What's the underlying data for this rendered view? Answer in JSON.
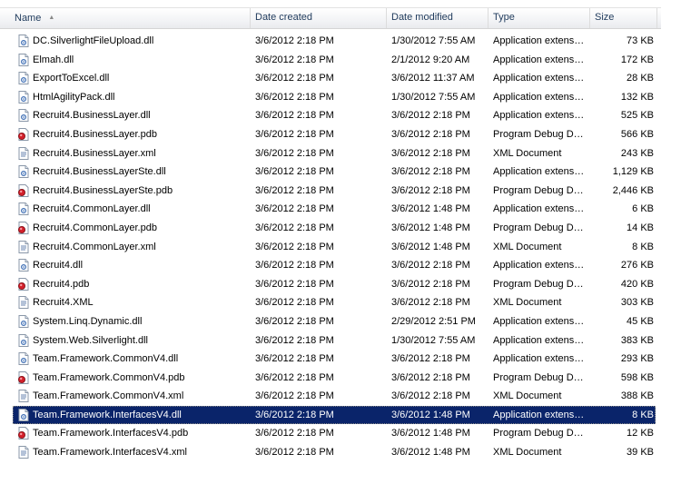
{
  "columns": {
    "name": "Name",
    "date_created": "Date created",
    "date_modified": "Date modified",
    "type": "Type",
    "size": "Size"
  },
  "colors": {
    "selection": "#0a246a",
    "header_text": "#1e395b"
  },
  "files": [
    {
      "name": "DC.SilverlightFileUpload.dll",
      "created": "3/6/2012 2:18 PM",
      "modified": "1/30/2012 7:55 AM",
      "type": "Application extension",
      "size": "73 KB",
      "icon": "dll-icon"
    },
    {
      "name": "Elmah.dll",
      "created": "3/6/2012 2:18 PM",
      "modified": "2/1/2012 9:20 AM",
      "type": "Application extension",
      "size": "172 KB",
      "icon": "dll-icon"
    },
    {
      "name": "ExportToExcel.dll",
      "created": "3/6/2012 2:18 PM",
      "modified": "3/6/2012 11:37 AM",
      "type": "Application extension",
      "size": "28 KB",
      "icon": "dll-icon"
    },
    {
      "name": "HtmlAgilityPack.dll",
      "created": "3/6/2012 2:18 PM",
      "modified": "1/30/2012 7:55 AM",
      "type": "Application extension",
      "size": "132 KB",
      "icon": "dll-icon"
    },
    {
      "name": "Recruit4.BusinessLayer.dll",
      "created": "3/6/2012 2:18 PM",
      "modified": "3/6/2012 2:18 PM",
      "type": "Application extension",
      "size": "525 KB",
      "icon": "dll-icon"
    },
    {
      "name": "Recruit4.BusinessLayer.pdb",
      "created": "3/6/2012 2:18 PM",
      "modified": "3/6/2012 2:18 PM",
      "type": "Program Debug Dat...",
      "size": "566 KB",
      "icon": "pdb-icon"
    },
    {
      "name": "Recruit4.BusinessLayer.xml",
      "created": "3/6/2012 2:18 PM",
      "modified": "3/6/2012 2:18 PM",
      "type": "XML Document",
      "size": "243 KB",
      "icon": "xml-icon"
    },
    {
      "name": "Recruit4.BusinessLayerSte.dll",
      "created": "3/6/2012 2:18 PM",
      "modified": "3/6/2012 2:18 PM",
      "type": "Application extension",
      "size": "1,129 KB",
      "icon": "dll-icon"
    },
    {
      "name": "Recruit4.BusinessLayerSte.pdb",
      "created": "3/6/2012 2:18 PM",
      "modified": "3/6/2012 2:18 PM",
      "type": "Program Debug Dat...",
      "size": "2,446 KB",
      "icon": "pdb-icon"
    },
    {
      "name": "Recruit4.CommonLayer.dll",
      "created": "3/6/2012 2:18 PM",
      "modified": "3/6/2012 1:48 PM",
      "type": "Application extension",
      "size": "6 KB",
      "icon": "dll-icon"
    },
    {
      "name": "Recruit4.CommonLayer.pdb",
      "created": "3/6/2012 2:18 PM",
      "modified": "3/6/2012 1:48 PM",
      "type": "Program Debug Dat...",
      "size": "14 KB",
      "icon": "pdb-icon"
    },
    {
      "name": "Recruit4.CommonLayer.xml",
      "created": "3/6/2012 2:18 PM",
      "modified": "3/6/2012 1:48 PM",
      "type": "XML Document",
      "size": "8 KB",
      "icon": "xml-icon"
    },
    {
      "name": "Recruit4.dll",
      "created": "3/6/2012 2:18 PM",
      "modified": "3/6/2012 2:18 PM",
      "type": "Application extension",
      "size": "276 KB",
      "icon": "dll-icon"
    },
    {
      "name": "Recruit4.pdb",
      "created": "3/6/2012 2:18 PM",
      "modified": "3/6/2012 2:18 PM",
      "type": "Program Debug Dat...",
      "size": "420 KB",
      "icon": "pdb-icon"
    },
    {
      "name": "Recruit4.XML",
      "created": "3/6/2012 2:18 PM",
      "modified": "3/6/2012 2:18 PM",
      "type": "XML Document",
      "size": "303 KB",
      "icon": "xml-icon"
    },
    {
      "name": "System.Linq.Dynamic.dll",
      "created": "3/6/2012 2:18 PM",
      "modified": "2/29/2012 2:51 PM",
      "type": "Application extension",
      "size": "45 KB",
      "icon": "dll-icon"
    },
    {
      "name": "System.Web.Silverlight.dll",
      "created": "3/6/2012 2:18 PM",
      "modified": "1/30/2012 7:55 AM",
      "type": "Application extension",
      "size": "383 KB",
      "icon": "dll-icon"
    },
    {
      "name": "Team.Framework.CommonV4.dll",
      "created": "3/6/2012 2:18 PM",
      "modified": "3/6/2012 2:18 PM",
      "type": "Application extension",
      "size": "293 KB",
      "icon": "dll-icon"
    },
    {
      "name": "Team.Framework.CommonV4.pdb",
      "created": "3/6/2012 2:18 PM",
      "modified": "3/6/2012 2:18 PM",
      "type": "Program Debug Dat...",
      "size": "598 KB",
      "icon": "pdb-icon"
    },
    {
      "name": "Team.Framework.CommonV4.xml",
      "created": "3/6/2012 2:18 PM",
      "modified": "3/6/2012 2:18 PM",
      "type": "XML Document",
      "size": "388 KB",
      "icon": "xml-icon"
    },
    {
      "name": "Team.Framework.InterfacesV4.dll",
      "created": "3/6/2012 2:18 PM",
      "modified": "3/6/2012 1:48 PM",
      "type": "Application extension",
      "size": "8 KB",
      "icon": "dll-icon",
      "selected": true
    },
    {
      "name": "Team.Framework.InterfacesV4.pdb",
      "created": "3/6/2012 2:18 PM",
      "modified": "3/6/2012 1:48 PM",
      "type": "Program Debug Dat...",
      "size": "12 KB",
      "icon": "pdb-icon"
    },
    {
      "name": "Team.Framework.InterfacesV4.xml",
      "created": "3/6/2012 2:18 PM",
      "modified": "3/6/2012 1:48 PM",
      "type": "XML Document",
      "size": "39 KB",
      "icon": "xml-icon"
    }
  ]
}
